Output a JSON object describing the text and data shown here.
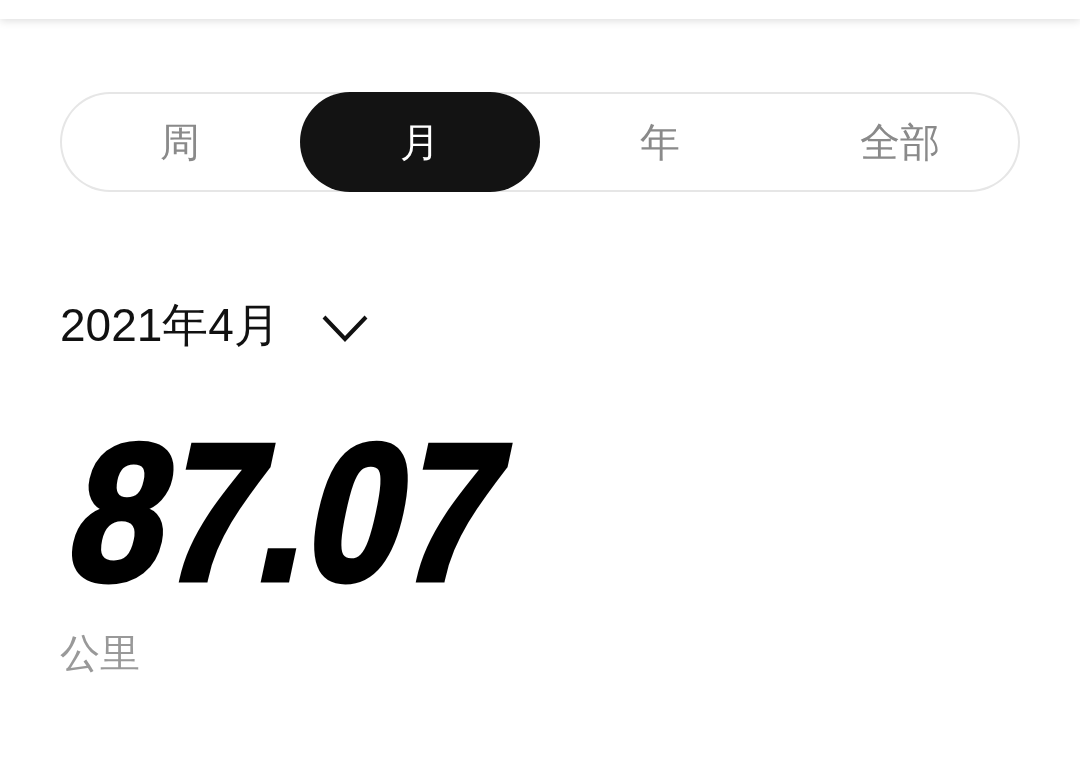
{
  "period_tabs": [
    {
      "label": "周",
      "selected": false
    },
    {
      "label": "月",
      "selected": true
    },
    {
      "label": "年",
      "selected": false
    },
    {
      "label": "全部",
      "selected": false
    }
  ],
  "period_picker": {
    "label": "2021年4月"
  },
  "distance": {
    "value": "87.07",
    "unit": "公里"
  }
}
